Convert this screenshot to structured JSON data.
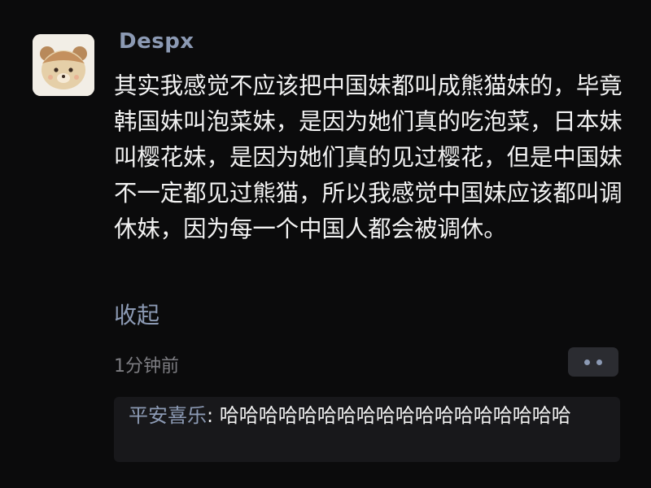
{
  "post": {
    "avatar_icon": "bear-avatar-icon",
    "username": "Despx",
    "content": "其实我感觉不应该把中国妹都叫成熊猫妹的，毕竟韩国妹叫泡菜妹，是因为她们真的吃泡菜，日本妹叫樱花妹，是因为她们真的见过樱花，但是中国妹不一定都见过熊猫，所以我感觉中国妹应该都叫调休妹，因为每一个中国人都会被调休。",
    "collapse_label": "收起",
    "time": "1分钟前",
    "more_icon": "more-dots-icon"
  },
  "comment": {
    "user": "平安喜乐",
    "separator": ": ",
    "text": "哈哈哈哈哈哈哈哈哈哈哈哈哈哈哈哈哈哈"
  },
  "colors": {
    "background": "#0b0b0c",
    "link": "#8c9ab4",
    "text": "#f2f2f2",
    "muted": "#7d7d82",
    "button_bg": "#2b2c31",
    "comment_bg": "#18181b"
  }
}
